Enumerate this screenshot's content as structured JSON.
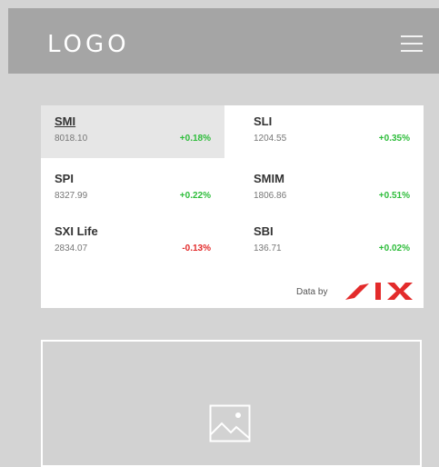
{
  "header": {
    "logo_text": "LOGO",
    "menu_icon": "hamburger-menu-icon"
  },
  "market": {
    "tiles": [
      {
        "name": "SMI",
        "value": "8018.10",
        "change": "+0.18%",
        "direction": "up",
        "selected": true
      },
      {
        "name": "SLI",
        "value": "1204.55",
        "change": "+0.35%",
        "direction": "up",
        "selected": false
      },
      {
        "name": "SPI",
        "value": "8327.99",
        "change": "+0.22%",
        "direction": "up",
        "selected": false
      },
      {
        "name": "SMIM",
        "value": "1806.86",
        "change": "+0.51%",
        "direction": "up",
        "selected": false
      },
      {
        "name": "SXI Life",
        "value": "2834.07",
        "change": "-0.13%",
        "direction": "down",
        "selected": false
      },
      {
        "name": "SBI",
        "value": "136.71",
        "change": "+0.02%",
        "direction": "up",
        "selected": false
      }
    ],
    "data_by_label": "Data by",
    "provider_logo": "six-logo",
    "colors": {
      "up": "#2ebd3b",
      "down": "#e32b2b",
      "brand": "#e32b2b"
    }
  },
  "media": {
    "placeholder_icon": "image-placeholder-icon"
  }
}
